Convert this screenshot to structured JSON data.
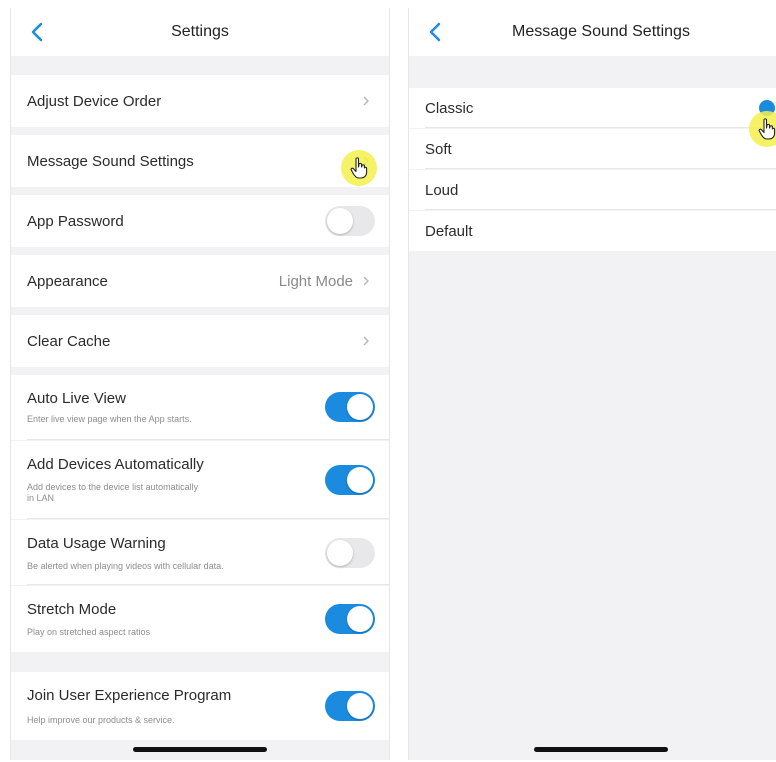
{
  "settings": {
    "title": "Settings",
    "items": {
      "adjust_order": {
        "label": "Adjust Device Order"
      },
      "message_sound": {
        "label": "Message Sound Settings"
      },
      "app_password": {
        "label": "App Password",
        "enabled": false
      },
      "appearance": {
        "label": "Appearance",
        "value": "Light Mode"
      },
      "clear_cache": {
        "label": "Clear Cache"
      },
      "auto_live_view": {
        "label": "Auto Live View",
        "description": "Enter live view page when the App starts.",
        "enabled": true
      },
      "add_devices_auto": {
        "label": "Add Devices Automatically",
        "description_line1": "Add devices to the device list automatically",
        "description_line2": "in LAN",
        "enabled": true
      },
      "data_usage_warning": {
        "label": "Data Usage Warning",
        "description": "Be alerted when playing videos with cellular data.",
        "enabled": false
      },
      "stretch_mode": {
        "label": "Stretch Mode",
        "description": "Play on stretched aspect ratios",
        "enabled": true
      },
      "join_ux_program": {
        "label": "Join User Experience Program",
        "description": "Help improve our products & service.",
        "enabled": true
      }
    }
  },
  "message_sound": {
    "title": "Message Sound Settings",
    "options": [
      {
        "label": "Classic",
        "selected": true
      },
      {
        "label": "Soft",
        "selected": false
      },
      {
        "label": "Loud",
        "selected": false
      },
      {
        "label": "Default",
        "selected": false
      }
    ]
  },
  "icons": {
    "back": "chevron-left-icon",
    "disclosure": "chevron-right-icon",
    "cursor": "hand-pointer-icon",
    "selected": "checkmark-icon"
  },
  "colors": {
    "accent": "#1b8be0",
    "background": "#f2f2f4",
    "toggle_off": "#e8e8ea",
    "cursor_highlight": "#f4f04a"
  }
}
